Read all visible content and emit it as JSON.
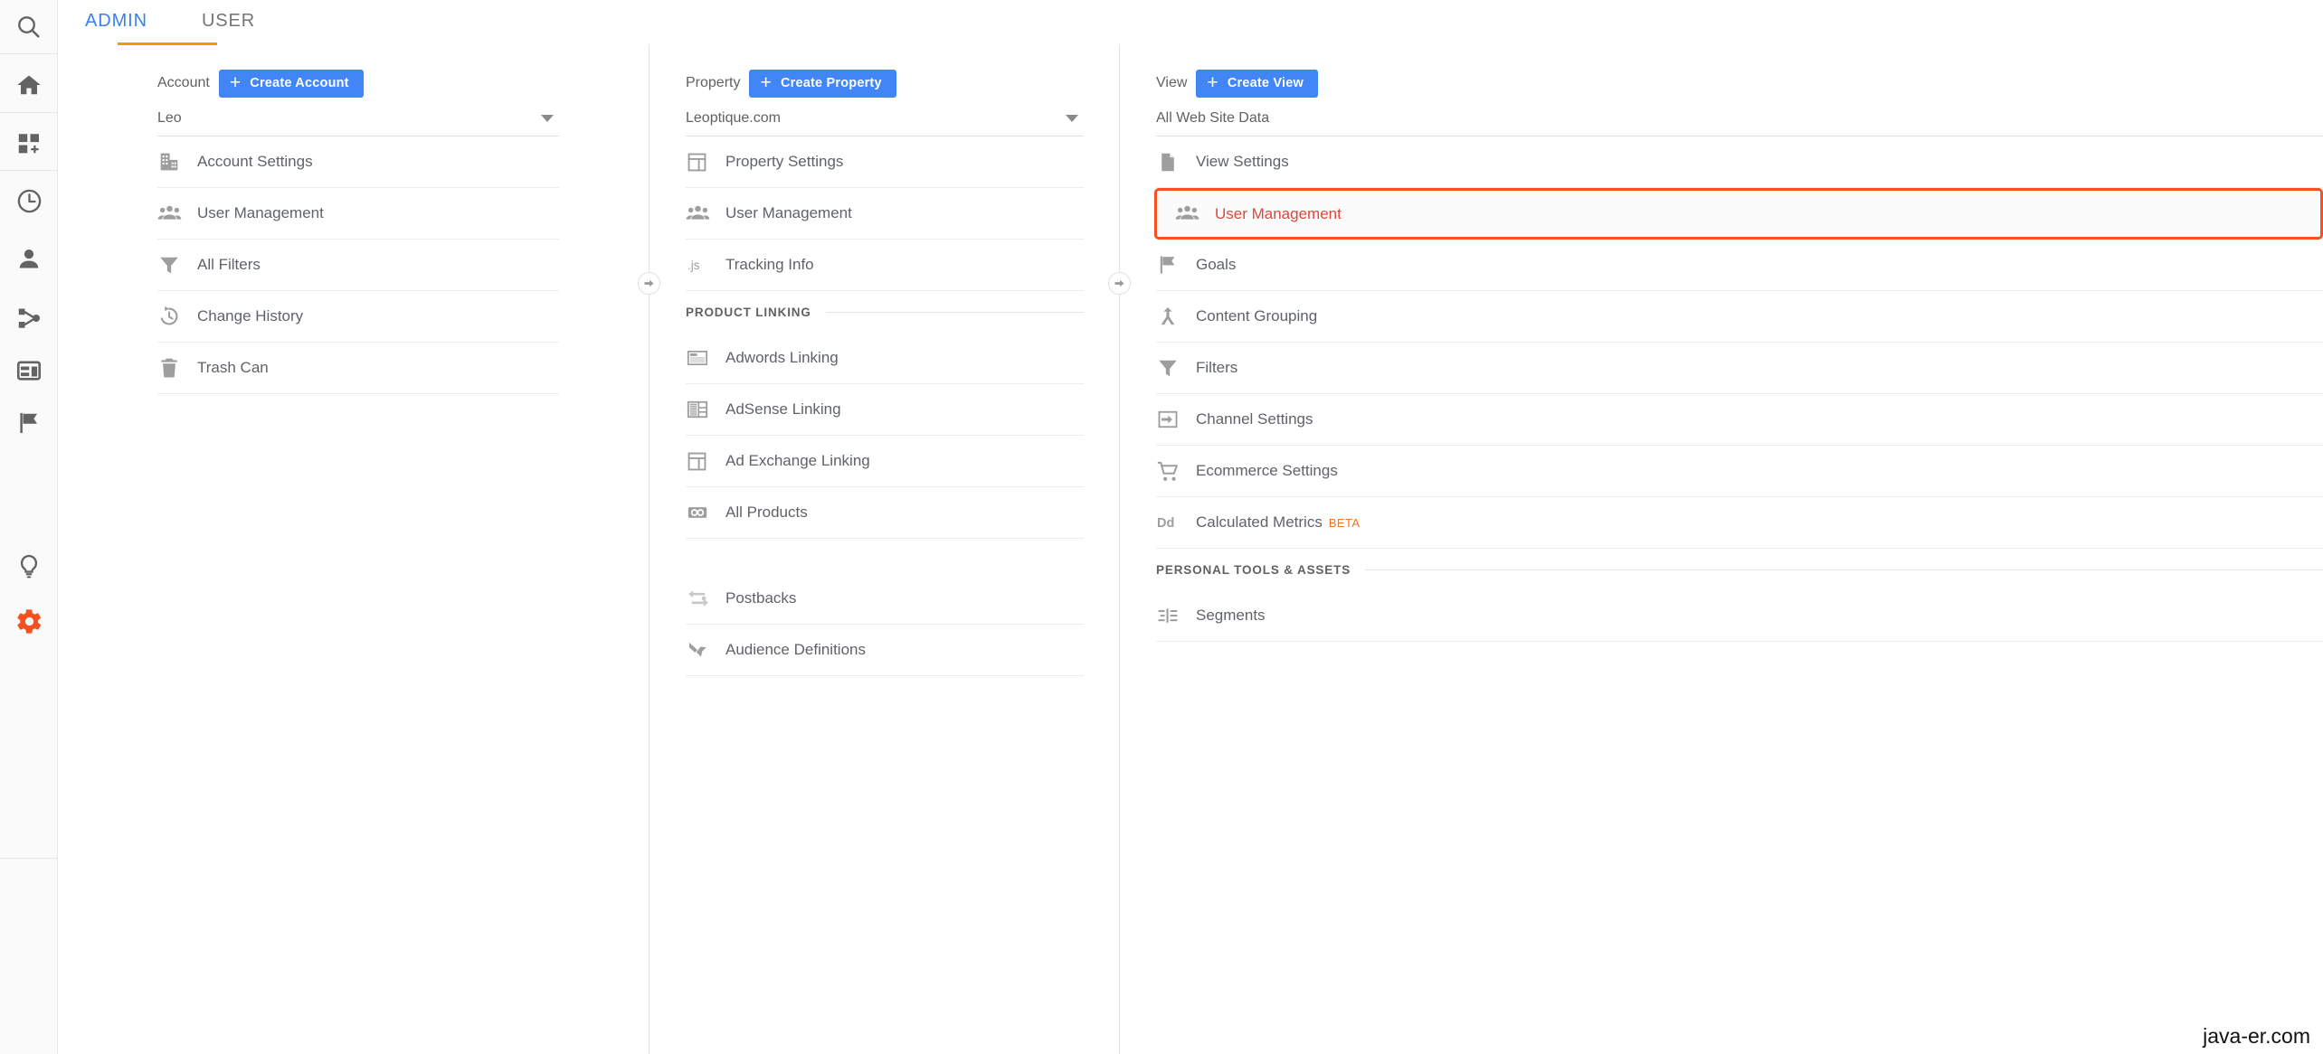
{
  "sidebar": {
    "items": [
      {
        "icon": "search-icon",
        "name": "search"
      },
      {
        "icon": "home-icon",
        "name": "home"
      },
      {
        "icon": "customization-icon",
        "name": "customization"
      },
      {
        "icon": "realtime-clock-icon",
        "name": "realtime"
      },
      {
        "icon": "audience-person-icon",
        "name": "audience"
      },
      {
        "icon": "acquisition-share-icon",
        "name": "acquisition"
      },
      {
        "icon": "behavior-layout-icon",
        "name": "behavior"
      },
      {
        "icon": "conversions-flag-icon",
        "name": "conversions"
      },
      {
        "icon": "discover-bulb-icon",
        "name": "discover"
      },
      {
        "icon": "admin-gear-icon",
        "name": "admin"
      }
    ]
  },
  "tabs": [
    {
      "label": "ADMIN",
      "active": true
    },
    {
      "label": "USER",
      "active": false
    }
  ],
  "account": {
    "header_label": "Account",
    "create_label": "Create Account",
    "selected": "Leo",
    "items": [
      {
        "label": "Account Settings",
        "icon": "building-icon"
      },
      {
        "label": "User Management",
        "icon": "people-icon"
      },
      {
        "label": "All Filters",
        "icon": "funnel-icon"
      },
      {
        "label": "Change History",
        "icon": "history-icon"
      },
      {
        "label": "Trash Can",
        "icon": "trash-icon"
      }
    ]
  },
  "property": {
    "header_label": "Property",
    "create_label": "Create Property",
    "selected": "Leoptique.com",
    "items": [
      {
        "label": "Property Settings",
        "icon": "layout-icon"
      },
      {
        "label": "User Management",
        "icon": "people-icon"
      },
      {
        "label": "Tracking Info",
        "icon": "js-icon"
      }
    ],
    "product_linking_label": "PRODUCT LINKING",
    "linking_items": [
      {
        "label": "Adwords Linking",
        "icon": "adwords-icon"
      },
      {
        "label": "AdSense Linking",
        "icon": "adsense-icon"
      },
      {
        "label": "Ad Exchange Linking",
        "icon": "layout-icon"
      },
      {
        "label": "All Products",
        "icon": "link-chain-icon"
      }
    ],
    "extra_items": [
      {
        "label": "Postbacks",
        "icon": "postbacks-icon"
      },
      {
        "label": "Audience Definitions",
        "icon": "audience-definitions-icon"
      }
    ]
  },
  "view": {
    "header_label": "View",
    "create_label": "Create View",
    "selected": "All Web Site Data",
    "items": [
      {
        "label": "View Settings",
        "icon": "document-icon",
        "highlighted": false,
        "beta": ""
      },
      {
        "label": "User Management",
        "icon": "people-icon",
        "highlighted": true,
        "beta": ""
      },
      {
        "label": "Goals",
        "icon": "flag-icon",
        "highlighted": false,
        "beta": ""
      },
      {
        "label": "Content Grouping",
        "icon": "content-grouping-icon",
        "highlighted": false,
        "beta": ""
      },
      {
        "label": "Filters",
        "icon": "funnel-icon",
        "highlighted": false,
        "beta": ""
      },
      {
        "label": "Channel Settings",
        "icon": "channel-icon",
        "highlighted": false,
        "beta": ""
      },
      {
        "label": "Ecommerce Settings",
        "icon": "cart-icon",
        "highlighted": false,
        "beta": ""
      },
      {
        "label": "Calculated Metrics",
        "icon": "dd-icon",
        "highlighted": false,
        "beta": "BETA"
      }
    ],
    "personal_tools_label": "PERSONAL TOOLS & ASSETS",
    "personal_items": [
      {
        "label": "Segments",
        "icon": "segments-icon"
      }
    ]
  },
  "watermark": "java-er.com",
  "colors": {
    "accent_blue": "#4285f4",
    "tab_active": "#3b80f0",
    "tab_underline": "#f29900",
    "highlight_border": "#f4511e",
    "highlight_text": "#e2463a",
    "beta_orange": "#ef7321",
    "gear_orange": "#f4511e",
    "icon_gray": "#9e9e9e",
    "text_gray": "#5f6368"
  }
}
